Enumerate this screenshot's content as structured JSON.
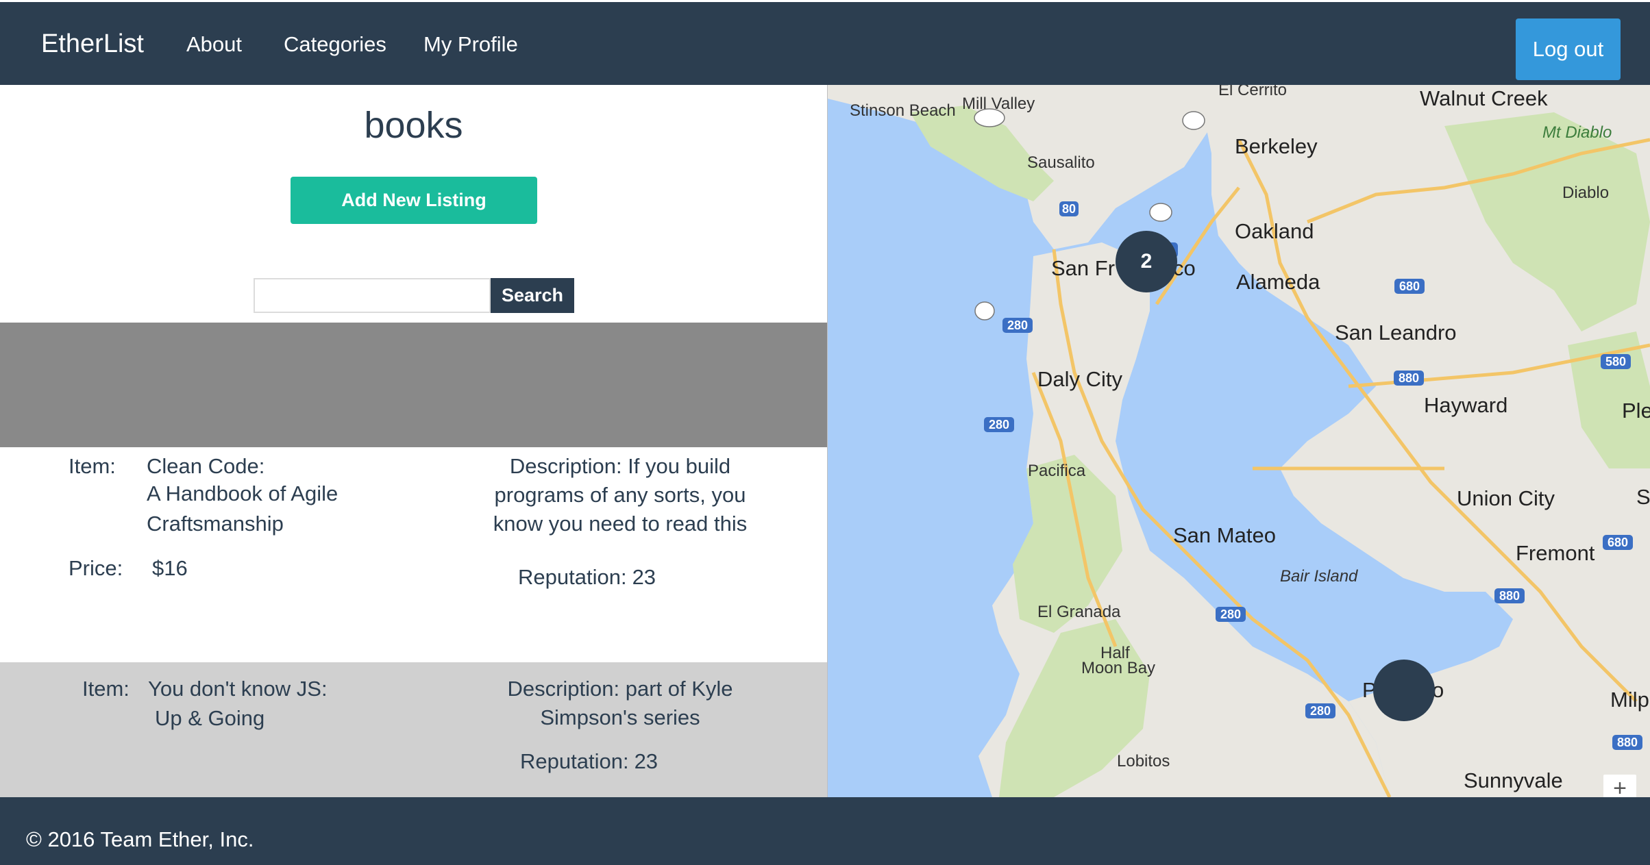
{
  "navbar": {
    "brand": "EtherList",
    "links": [
      "About",
      "Categories",
      "My Profile"
    ],
    "logout": "Log out"
  },
  "page": {
    "title": "books",
    "add_button": "Add New Listing",
    "search_placeholder": "",
    "search_button": "Search"
  },
  "listings": [
    {
      "item_label": "Item:",
      "item_lines": [
        "Clean Code:",
        "A Handbook of Agile",
        "Craftsmanship"
      ],
      "desc_lines": [
        "Description: If you build",
        "programs of any sorts, you",
        "know you need to read this"
      ],
      "price_label": "Price:",
      "price": "$16",
      "rep_label": "Reputation:",
      "rep_value": "23"
    },
    {
      "item_label": "Item:",
      "item_lines": [
        "You don't know JS:",
        "Up & Going"
      ],
      "desc_lines": [
        "Description: part of Kyle",
        "Simpson's series"
      ],
      "rep_label": "Reputation:",
      "rep_value": "23"
    }
  ],
  "map": {
    "labels": [
      "Stinson Beach",
      "Mill Valley",
      "El Cerrito",
      "Walnut Creek",
      "Mt Diablo",
      "Berkeley",
      "Sausalito",
      "Diablo",
      "Oakland",
      "San Fr",
      "co",
      "Alameda",
      "San Leandro",
      "Daly City",
      "Hayward",
      "Plea",
      "Pacifica",
      "Union City",
      "San Mateo",
      "Fremont",
      "Bair Island",
      "El Granada",
      "Half",
      "Moon Bay",
      "P",
      "o",
      "Milpi",
      "Lobitos",
      "Sunnyvale",
      "Su"
    ],
    "clusters": [
      "2",
      ""
    ],
    "zoom_in": "+"
  },
  "footer": {
    "text": "© 2016 Team Ether, Inc."
  },
  "colors": {
    "navbar": "#2c3e50",
    "add_button": "#1abc9c",
    "logout": "#3498db",
    "water": "#a9cdf9",
    "land": "#e9e7e1"
  }
}
